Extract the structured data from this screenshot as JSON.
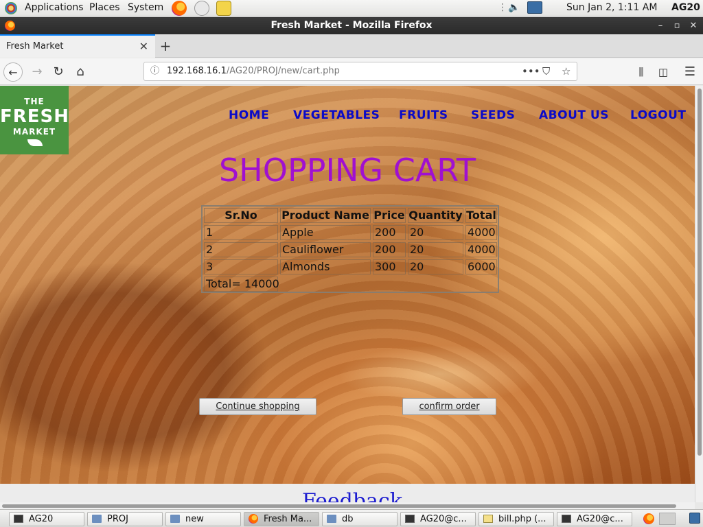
{
  "top_panel": {
    "menus": [
      "Applications",
      "Places",
      "System"
    ],
    "clock": "Sun Jan  2,  1:11 AM",
    "user": "AG20"
  },
  "window": {
    "title": "Fresh Market - Mozilla Firefox",
    "controls": {
      "minimize": "–",
      "maximize": "▫",
      "close": "✕"
    }
  },
  "browser": {
    "tab_title": "Fresh Market",
    "tab_close": "✕",
    "new_tab": "+",
    "url_host": "192.168.16.1",
    "url_path": "/AG20/PROJ/new/cart.php",
    "info_icon": "ⓘ",
    "page_actions": "•••"
  },
  "page": {
    "logo": {
      "line1": "THE",
      "line2": "FRESH",
      "line3": "MARKET"
    },
    "nav": [
      "HOME",
      "VEGETABLES",
      "FRUITS",
      "SEEDS",
      "ABOUT US",
      "LOGOUT"
    ],
    "title": "SHOPPING CART",
    "table": {
      "headers": [
        "Sr.No",
        "Product Name",
        "Price",
        "Quantity",
        "Total"
      ],
      "rows": [
        [
          "1",
          "Apple",
          "200",
          "20",
          "4000"
        ],
        [
          "2",
          "Cauliflower",
          "200",
          "20",
          "4000"
        ],
        [
          "3",
          "Almonds",
          "300",
          "20",
          "6000"
        ]
      ],
      "grand_total": "Total= 14000"
    },
    "buttons": {
      "continue": "Continue shopping",
      "confirm": "confirm order"
    },
    "feedback_heading": "Feedback"
  },
  "taskbar": {
    "tasks": [
      {
        "label": "AG20",
        "icon": "terminal-icon"
      },
      {
        "label": "PROJ",
        "icon": "folder-icon"
      },
      {
        "label": "new",
        "icon": "folder-icon"
      },
      {
        "label": "Fresh Ma...",
        "icon": "firefox-icon",
        "active": true
      },
      {
        "label": "db",
        "icon": "folder-icon"
      },
      {
        "label": "AG20@c...",
        "icon": "terminal-icon"
      },
      {
        "label": "bill.php (...",
        "icon": "text-editor-icon"
      },
      {
        "label": "AG20@c...",
        "icon": "terminal-icon"
      }
    ]
  },
  "colors": {
    "nav_link": "#0a0ac8",
    "cart_title": "#a010d0",
    "logo_green": "#4a9440",
    "feedback_heading": "#1c1cd0",
    "active_tab_accent": "#0a84ff"
  }
}
